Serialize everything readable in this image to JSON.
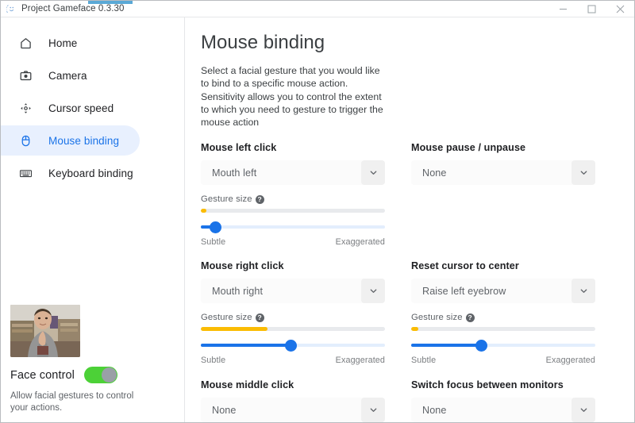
{
  "window": {
    "title": "Project Gameface 0.3.30",
    "app_icon": "smiley-face-icon",
    "controls": {
      "minimize": "minimize-icon",
      "maximize": "maximize-icon",
      "close": "close-icon"
    }
  },
  "sidebar": {
    "items": [
      {
        "label": "Home",
        "icon": "home-icon",
        "active": false
      },
      {
        "label": "Camera",
        "icon": "camera-icon",
        "active": false
      },
      {
        "label": "Cursor speed",
        "icon": "cursor-speed-icon",
        "active": false
      },
      {
        "label": "Mouse binding",
        "icon": "mouse-icon",
        "active": true
      },
      {
        "label": "Keyboard binding",
        "icon": "keyboard-icon",
        "active": false
      }
    ],
    "camera_preview": "webcam-preview",
    "face_control": {
      "label": "Face control",
      "enabled": true,
      "description": "Allow facial gestures to control your actions."
    }
  },
  "main": {
    "title": "Mouse binding",
    "description": "Select a facial gesture that you would like to bind to a specific mouse action. Sensitivity allows you to control  the extent to which you need to gesture to trigger the mouse action",
    "gesture_size_label": "Gesture size",
    "help_glyph": "?",
    "slider_min_label": "Subtle",
    "slider_max_label": "Exaggerated",
    "bindings": [
      {
        "name": "Mouse left click",
        "gesture": "Mouth left",
        "has_slider": true,
        "meter_percent": 3,
        "slider_percent": 8
      },
      {
        "name": "Mouse pause / unpause",
        "gesture": "None",
        "has_slider": false,
        "meter_percent": 0,
        "slider_percent": 0
      },
      {
        "name": "Mouse right click",
        "gesture": "Mouth right",
        "has_slider": true,
        "meter_percent": 36,
        "slider_percent": 49
      },
      {
        "name": "Reset cursor to center",
        "gesture": "Raise left eyebrow",
        "has_slider": true,
        "meter_percent": 4,
        "slider_percent": 38
      },
      {
        "name": "Mouse middle click",
        "gesture": "None",
        "has_slider": false,
        "meter_percent": 0,
        "slider_percent": 0
      },
      {
        "name": "Switch focus between monitors",
        "gesture": "None",
        "has_slider": false,
        "meter_percent": 0,
        "slider_percent": 0
      }
    ]
  },
  "colors": {
    "accent": "#1a73e8",
    "accent_bg": "#e8f0fe",
    "meter": "#fbbc04",
    "toggle_on": "#4cd137",
    "text": "#202124",
    "muted": "#5f6368"
  }
}
